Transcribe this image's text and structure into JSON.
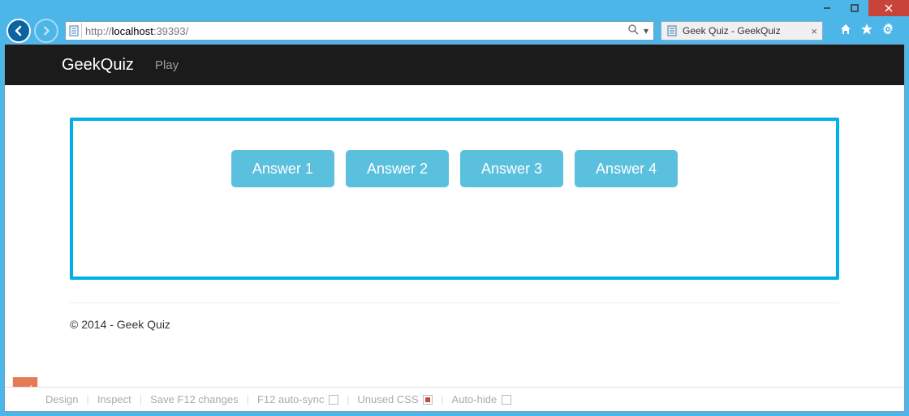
{
  "window": {
    "min_label": "–",
    "max_label": "▢",
    "close_label": "×"
  },
  "address_bar": {
    "url_prefix": "http://",
    "url_host": "localhost",
    "url_suffix": ":39393/"
  },
  "tab": {
    "title": "Geek Quiz - GeekQuiz"
  },
  "page": {
    "brand": "GeekQuiz",
    "nav": {
      "play": "Play"
    },
    "answers": [
      "Answer 1",
      "Answer 2",
      "Answer 3",
      "Answer 4"
    ],
    "footer": "© 2014 - Geek Quiz"
  },
  "dev_toolbar": {
    "design": "Design",
    "inspect": "Inspect",
    "save": "Save F12 changes",
    "autosync": "F12 auto-sync",
    "unused": "Unused CSS",
    "autohide": "Auto-hide"
  }
}
